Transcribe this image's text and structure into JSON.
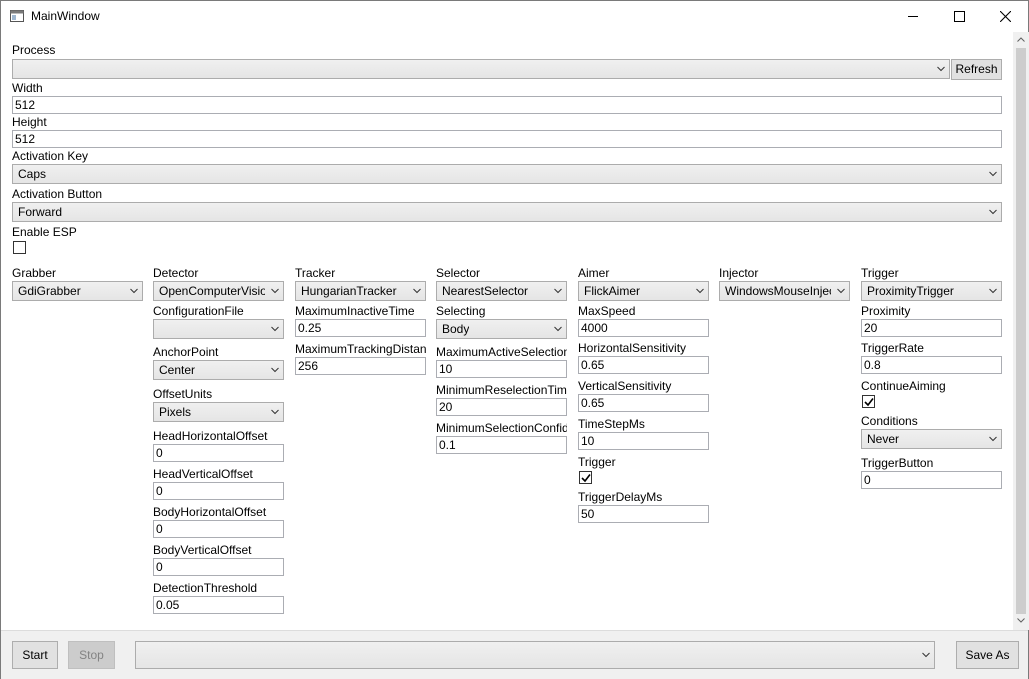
{
  "window": {
    "title": "MainWindow"
  },
  "process": {
    "label": "Process",
    "value": "",
    "refresh_label": "Refresh"
  },
  "width": {
    "label": "Width",
    "value": "512"
  },
  "height": {
    "label": "Height",
    "value": "512"
  },
  "activation_key": {
    "label": "Activation Key",
    "value": "Caps"
  },
  "activation_button": {
    "label": "Activation Button",
    "value": "Forward"
  },
  "enable_esp": {
    "label": "Enable ESP",
    "checked": false
  },
  "grabber": {
    "label": "Grabber",
    "value": "GdiGrabber"
  },
  "detector": {
    "label": "Detector",
    "value": "OpenComputerVision",
    "configuration_file_label": "ConfigurationFile",
    "configuration_file_value": "",
    "anchor_point_label": "AnchorPoint",
    "anchor_point_value": "Center",
    "offset_units_label": "OffsetUnits",
    "offset_units_value": "Pixels",
    "head_horizontal_offset_label": "HeadHorizontalOffset",
    "head_horizontal_offset_value": "0",
    "head_vertical_offset_label": "HeadVerticalOffset",
    "head_vertical_offset_value": "0",
    "body_horizontal_offset_label": "BodyHorizontalOffset",
    "body_horizontal_offset_value": "0",
    "body_vertical_offset_label": "BodyVerticalOffset",
    "body_vertical_offset_value": "0",
    "detection_threshold_label": "DetectionThreshold",
    "detection_threshold_value": "0.05"
  },
  "tracker": {
    "label": "Tracker",
    "value": "HungarianTracker",
    "maximum_inactive_time_label": "MaximumInactiveTime",
    "maximum_inactive_time_value": "0.25",
    "maximum_tracking_distance_label": "MaximumTrackingDistance",
    "maximum_tracking_distance_value": "256"
  },
  "selector": {
    "label": "Selector",
    "value": "NearestSelector",
    "selecting_label": "Selecting",
    "selecting_value": "Body",
    "maximum_active_selection_label": "MaximumActiveSelection",
    "maximum_active_selection_value": "10",
    "minimum_reselection_time_label": "MinimumReselectionTime",
    "minimum_reselection_time_value": "20",
    "minimum_selection_confidence_label": "MinimumSelectionConfidence",
    "minimum_selection_confidence_value": "0.1"
  },
  "aimer": {
    "label": "Aimer",
    "value": "FlickAimer",
    "max_speed_label": "MaxSpeed",
    "max_speed_value": "4000",
    "horizontal_sensitivity_label": "HorizontalSensitivity",
    "horizontal_sensitivity_value": "0.65",
    "vertical_sensitivity_label": "VerticalSensitivity",
    "vertical_sensitivity_value": "0.65",
    "time_step_ms_label": "TimeStepMs",
    "time_step_ms_value": "10",
    "trigger_label": "Trigger",
    "trigger_checked": true,
    "trigger_delay_ms_label": "TriggerDelayMs",
    "trigger_delay_ms_value": "50"
  },
  "injector": {
    "label": "Injector",
    "value": "WindowsMouseInjector"
  },
  "trigger": {
    "label": "Trigger",
    "value": "ProximityTrigger",
    "proximity_label": "Proximity",
    "proximity_value": "20",
    "trigger_rate_label": "TriggerRate",
    "trigger_rate_value": "0.8",
    "continue_aiming_label": "ContinueAiming",
    "continue_aiming_checked": true,
    "conditions_label": "Conditions",
    "conditions_value": "Never",
    "trigger_button_label": "TriggerButton",
    "trigger_button_value": "0"
  },
  "footer": {
    "start_label": "Start",
    "stop_label": "Stop",
    "profile_value": "",
    "save_as_label": "Save As"
  },
  "colors": {
    "accent": "#ffffff",
    "control_border": "#acacac",
    "footer_bg": "#f0f0f0"
  }
}
